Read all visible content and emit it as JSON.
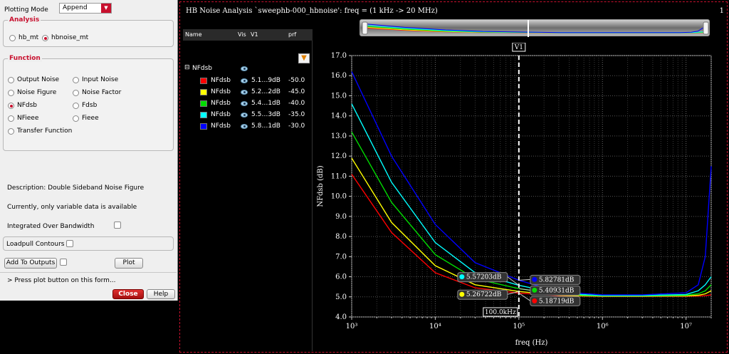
{
  "form": {
    "plotting_mode_label": "Plotting Mode",
    "plotting_mode_value": "Append",
    "analysis": {
      "title": "Analysis",
      "options": [
        {
          "label": "hb_mt",
          "selected": false
        },
        {
          "label": "hbnoise_mt",
          "selected": true
        }
      ]
    },
    "function": {
      "title": "Function",
      "options": [
        {
          "label": "Output Noise",
          "selected": false
        },
        {
          "label": "Input Noise",
          "selected": false
        },
        {
          "label": "Noise Figure",
          "selected": false
        },
        {
          "label": "Noise Factor",
          "selected": false
        },
        {
          "label": "NFdsb",
          "selected": true
        },
        {
          "label": "Fdsb",
          "selected": false
        },
        {
          "label": "NFieee",
          "selected": false
        },
        {
          "label": "Fieee",
          "selected": false
        },
        {
          "label": "Transfer Function",
          "selected": false
        }
      ]
    },
    "description": "Description: Double Sideband Noise Figure",
    "note": "Currently, only variable data is available",
    "integrated_label": "Integrated Over Bandwidth",
    "loadpull_label": "Loadpull Contours",
    "add_outputs_label": "Add To Outputs",
    "plot_label": "Plot",
    "status": "> Press plot button on this form...",
    "close_label": "Close",
    "help_label": "Help"
  },
  "window": {
    "title": "HB Noise Analysis `sweephb-000_hbnoise': freq = (1 kHz -> 20 MHz)",
    "number": "1"
  },
  "legend": {
    "headers": {
      "name": "Name",
      "vis": "Vis",
      "v1": "V1",
      "prf": "prf"
    },
    "group": "NFdsb",
    "rows": [
      {
        "name": "NFdsb",
        "color": "#ff0000",
        "v1": "5.1…9dB",
        "prf": "-50.0"
      },
      {
        "name": "NFdsb",
        "color": "#ffff00",
        "v1": "5.2…2dB",
        "prf": "-45.0"
      },
      {
        "name": "NFdsb",
        "color": "#00dd00",
        "v1": "5.4…1dB",
        "prf": "-40.0"
      },
      {
        "name": "NFdsb",
        "color": "#00ffff",
        "v1": "5.5…3dB",
        "prf": "-35.0"
      },
      {
        "name": "NFdsb",
        "color": "#0000ff",
        "v1": "5.8…1dB",
        "prf": "-30.0"
      }
    ]
  },
  "marker": {
    "label": "V1",
    "value_label": "100.0kHz",
    "readouts_left": [
      "5.57203dB",
      "5.26722dB"
    ],
    "readouts_right": [
      "5.82781dB",
      "5.40931dB",
      "5.18719dB"
    ]
  },
  "chart_data": {
    "type": "line",
    "xlabel": "freq (Hz)",
    "ylabel": "NFdsb (dB)",
    "xscale": "log",
    "xlim": [
      1000,
      20000000
    ],
    "ylim": [
      4.0,
      17.0
    ],
    "yticks": [
      "4.0",
      "5.0",
      "6.0",
      "7.0",
      "8.0",
      "9.0",
      "10.0",
      "11.0",
      "12.0",
      "13.0",
      "14.0",
      "15.0",
      "16.0",
      "17.0"
    ],
    "xticks": [
      "10³",
      "10⁴",
      "10⁵",
      "10⁶",
      "10⁷"
    ],
    "grid": true,
    "x": [
      1000,
      3000,
      10000,
      30000,
      100000,
      300000,
      1000000,
      3000000,
      10000000,
      14000000,
      17000000,
      20000000
    ],
    "series": [
      {
        "name": "prf=-50.0",
        "color": "#ff0000",
        "values": [
          11.1,
          8.2,
          6.2,
          5.45,
          5.187,
          5.06,
          5.02,
          5.02,
          5.03,
          5.04,
          5.06,
          5.1
        ]
      },
      {
        "name": "prf=-45.0",
        "color": "#ffff00",
        "values": [
          11.9,
          8.7,
          6.55,
          5.6,
          5.267,
          5.08,
          5.03,
          5.03,
          5.05,
          5.08,
          5.15,
          5.3
        ]
      },
      {
        "name": "prf=-40.0",
        "color": "#00dd00",
        "values": [
          13.2,
          9.7,
          7.1,
          5.9,
          5.409,
          5.12,
          5.05,
          5.05,
          5.08,
          5.15,
          5.3,
          5.6
        ]
      },
      {
        "name": "prf=-35.0",
        "color": "#00ffff",
        "values": [
          14.6,
          10.7,
          7.7,
          6.2,
          5.572,
          5.17,
          5.07,
          5.07,
          5.12,
          5.3,
          5.6,
          6.0
        ]
      },
      {
        "name": "prf=-30.0",
        "color": "#0000ff",
        "values": [
          16.2,
          12.0,
          8.6,
          6.7,
          5.828,
          5.25,
          5.1,
          5.1,
          5.2,
          5.6,
          7.0,
          11.5
        ]
      }
    ],
    "marker_x": 100000
  }
}
